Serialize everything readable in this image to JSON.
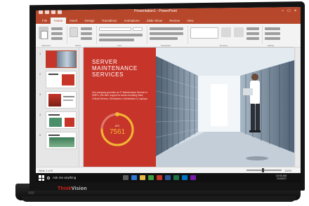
{
  "window": {
    "title": "Presentation1 - PowerPoint",
    "controls": [
      "−",
      "□",
      "×"
    ]
  },
  "ribbon": {
    "tabs": [
      "File",
      "Home",
      "Insert",
      "Design",
      "Transitions",
      "Animations",
      "Slide Show",
      "Review",
      "View"
    ],
    "active_tab": "Home",
    "groups": [
      "Clipboard",
      "Slides",
      "Font",
      "Paragraph",
      "Drawing",
      "Editing"
    ]
  },
  "slide": {
    "title_lines": [
      "SERVER",
      "MAINTENANCE",
      "SERVICES"
    ],
    "body": "Our company provides an IT Maintenance Service to SME's. We offer support to areas including Data, Critical Servers, Workstation, Workstation & Laptops.",
    "gauge_label": "KPI",
    "gauge_value": "7561",
    "gauge_fraction": 0.75,
    "accent_color": "#c7352a",
    "gauge_color": "#f2b632"
  },
  "status": {
    "text": "Slide 1 of 5",
    "zoom": "100%"
  },
  "taskbar": {
    "search_placeholder": "Ask me anything",
    "time": "10:05 AM",
    "date": "1/1/2017"
  },
  "hardware": {
    "brand_prefix": "Think",
    "brand_suffix": "Vision"
  }
}
